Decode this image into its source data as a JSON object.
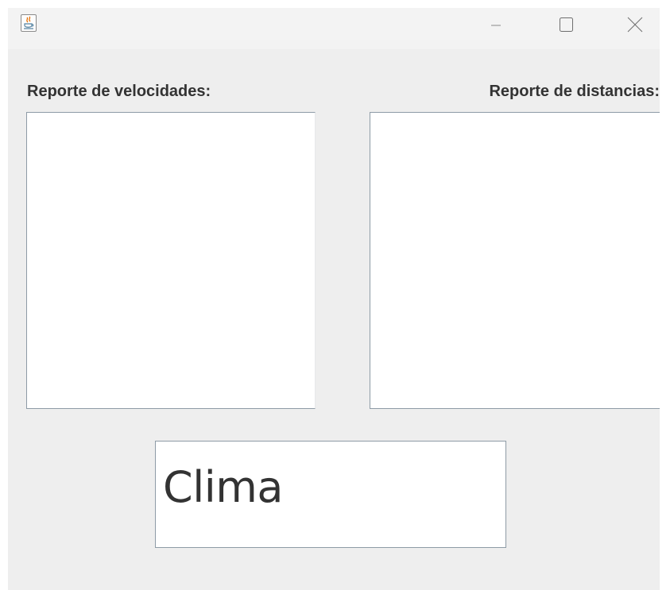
{
  "window": {
    "icon": "java-icon",
    "controls": {
      "minimize_icon": "minimize-icon",
      "maximize_icon": "maximize-icon",
      "close_icon": "close-icon"
    }
  },
  "labels": {
    "speeds": "Reporte de velocidades:",
    "distances": "Reporte de distancias:"
  },
  "text_areas": {
    "speeds_value": "",
    "distances_value": ""
  },
  "weather": {
    "value": "Clima"
  },
  "colors": {
    "window_bg": "#eeeeee",
    "titlebar_bg": "#f3f3f3",
    "field_border": "#8e9ba6",
    "text": "#333333",
    "java_accent": "#e76f00",
    "java_blue": "#5382a1"
  }
}
